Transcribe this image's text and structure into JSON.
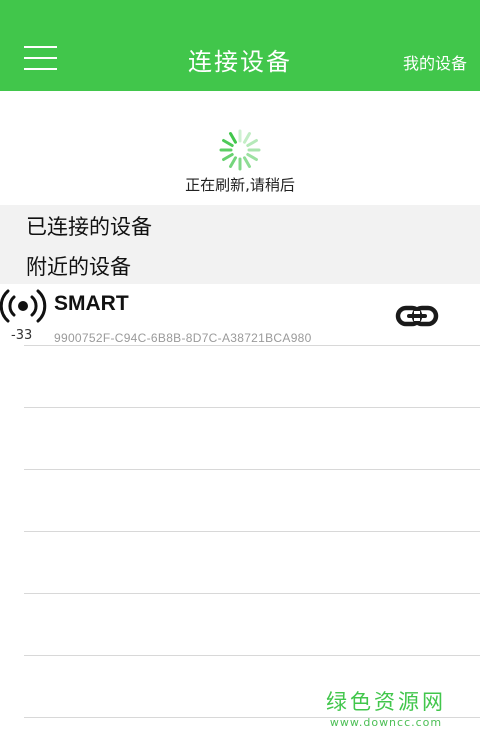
{
  "header": {
    "title": "连接设备",
    "right_action": "我的设备",
    "menu_icon": "hamburger-menu-icon",
    "background_color": "#41c64b"
  },
  "status": {
    "refresh_text": "正在刷新,请稍后",
    "spinner_icon": "loading-spinner-icon"
  },
  "sections": {
    "connected_label": "已连接的设备",
    "nearby_label": "附近的设备"
  },
  "devices": [
    {
      "name": "SMART",
      "uuid": "9900752F-C94C-6B8B-8D7C-A38721BCA980",
      "rssi": "-33",
      "signal_icon": "bluetooth-signal-icon",
      "action_icon": "link-icon"
    }
  ],
  "watermark": {
    "main": "绿色资源网",
    "url": "www.downcc.com"
  }
}
